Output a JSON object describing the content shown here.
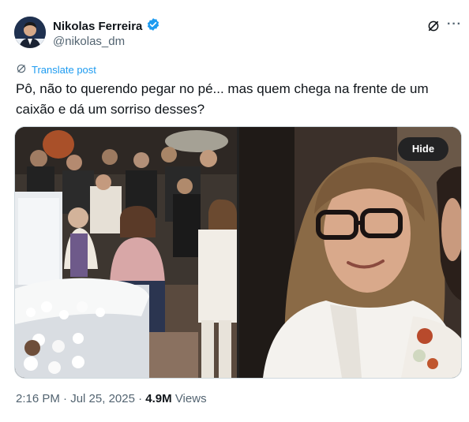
{
  "author": {
    "display_name": "Nikolas Ferreira",
    "handle": "@nikolas_dm",
    "verified_icon": "verified-badge-icon"
  },
  "actions": {
    "grok_icon": "grok-icon",
    "more_label": "···"
  },
  "post": {
    "translate_label": "Translate post",
    "text": "Pô, não to querendo pegar no pé... mas quem chega na frente de um caixão e dá um sorriso desses?"
  },
  "media": {
    "hide_label": "Hide"
  },
  "meta": {
    "time": "2:16 PM",
    "separator": "·",
    "date": "Jul 25, 2025",
    "views_count": "4.9M",
    "views_label": "Views"
  },
  "colors": {
    "accent": "#1d9bf0",
    "secondary_text": "#536471",
    "primary_text": "#0f1419"
  }
}
